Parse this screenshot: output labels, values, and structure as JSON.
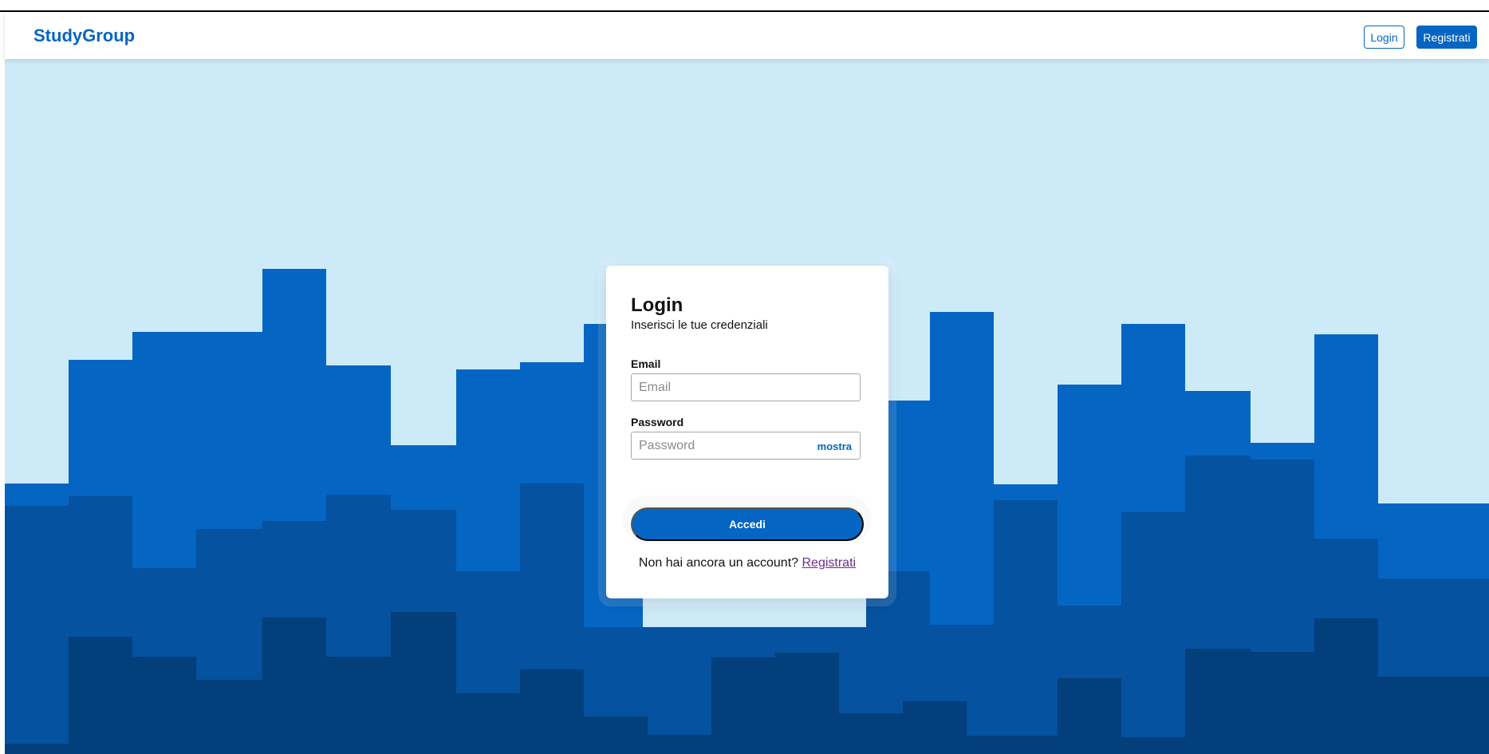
{
  "navbar": {
    "brand": "StudyGroup",
    "login_label": "Login",
    "register_label": "Registrati"
  },
  "colors": {
    "primary": "#0565c2",
    "sky": "#cdeaf9",
    "band_1": "#0565c2",
    "band_2": "#0452a0",
    "band_3": "#033f7a"
  },
  "login_card": {
    "title": "Login",
    "subtitle": "Inserisci le tue credenziali",
    "email_label": "Email",
    "email_placeholder": "Email",
    "email_value": "",
    "password_label": "Password",
    "password_placeholder": "Password",
    "password_value": "",
    "show_password_label": "mostra",
    "submit_label": "Accedi",
    "no_account_text": "Non hai ancora un account?",
    "register_link": "Registrati"
  }
}
